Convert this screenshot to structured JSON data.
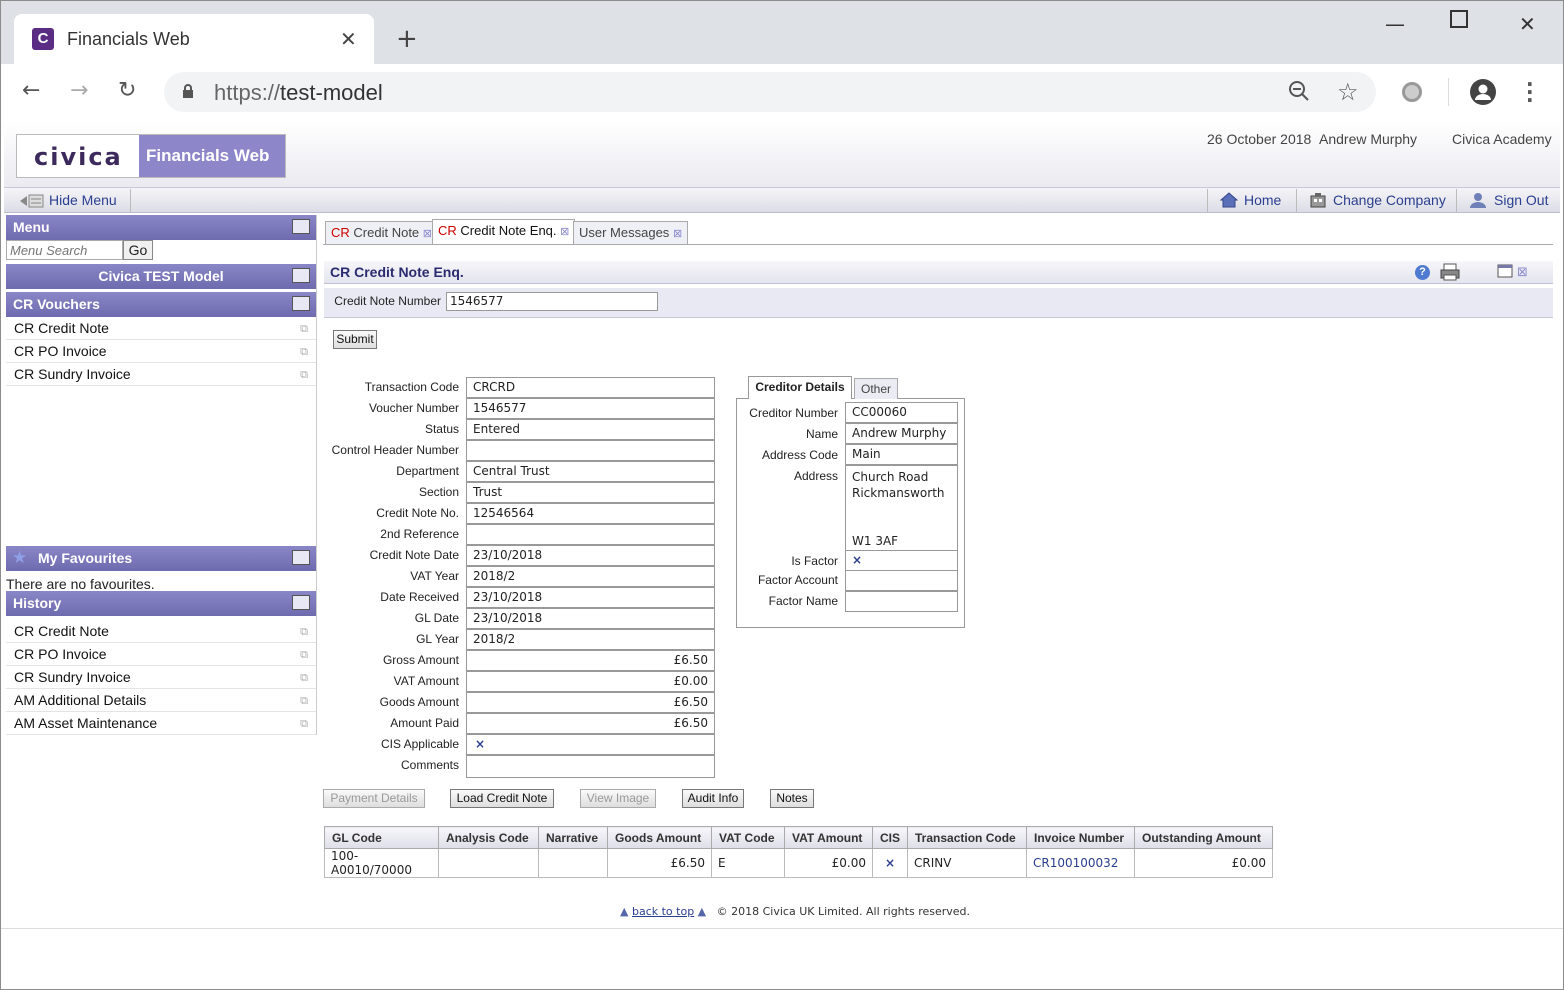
{
  "browser": {
    "tab_title": "Financials Web",
    "favicon_letter": "C",
    "url_scheme": "https://",
    "url_host": "test-model"
  },
  "header": {
    "logo_text": "civica",
    "app_name": "Financials Web",
    "date": "26 October 2018",
    "user": "Andrew Murphy",
    "organisation": "Civica Academy"
  },
  "toolbar": {
    "hide_menu": "Hide Menu",
    "home": "Home",
    "change_company": "Change Company",
    "sign_out": "Sign Out"
  },
  "sidebar": {
    "menu_title": "Menu",
    "search_placeholder": "Menu Search",
    "go_label": "Go",
    "model_title": "Civica TEST Model",
    "vouchers_title": "CR Vouchers",
    "voucher_items": [
      "CR Credit Note",
      "CR PO Invoice",
      "CR Sundry Invoice"
    ],
    "favourites_title": "My Favourites",
    "favourites_empty": "There are no favourites.",
    "history_title": "History",
    "history_items": [
      "CR Credit Note",
      "CR PO Invoice",
      "CR Sundry Invoice",
      "AM Additional Details",
      "AM Asset Maintenance"
    ]
  },
  "tabs": [
    {
      "prefix": "CR",
      "label": "Credit Note"
    },
    {
      "prefix": "CR",
      "label": "Credit Note Enq."
    },
    {
      "prefix": "",
      "label": "User Messages"
    }
  ],
  "form": {
    "title": "CR Credit Note Enq.",
    "search_label": "Credit Note Number",
    "search_value": "1546577",
    "submit_label": "Submit",
    "fields": [
      {
        "label": "Transaction Code",
        "value": "CRCRD"
      },
      {
        "label": "Voucher Number",
        "value": "1546577"
      },
      {
        "label": "Status",
        "value": "Entered"
      },
      {
        "label": "Control Header Number",
        "value": ""
      },
      {
        "label": "Department",
        "value": "Central Trust"
      },
      {
        "label": "Section",
        "value": "Trust"
      },
      {
        "label": "Credit Note No.",
        "value": "12546564"
      },
      {
        "label": "2nd Reference",
        "value": ""
      },
      {
        "label": "Credit Note Date",
        "value": "23/10/2018"
      },
      {
        "label": "VAT Year",
        "value": "2018/2"
      },
      {
        "label": "Date Received",
        "value": "23/10/2018"
      },
      {
        "label": "GL Date",
        "value": "23/10/2018"
      },
      {
        "label": "GL Year",
        "value": "2018/2"
      },
      {
        "label": "Gross Amount",
        "value": "£6.50"
      },
      {
        "label": "VAT Amount",
        "value": "£0.00"
      },
      {
        "label": "Goods Amount",
        "value": "£6.50"
      },
      {
        "label": "Amount Paid",
        "value": "£6.50"
      },
      {
        "label": "CIS Applicable",
        "value": "×"
      },
      {
        "label": "Comments",
        "value": ""
      }
    ]
  },
  "creditor": {
    "tab_details": "Creditor Details",
    "tab_other": "Other",
    "creditor_number_label": "Creditor Number",
    "creditor_number": "CC00060",
    "name_label": "Name",
    "name": "Andrew Murphy",
    "address_code_label": "Address Code",
    "address_code": "Main",
    "address_label": "Address",
    "address_line1": "Church Road",
    "address_line2": "Rickmansworth",
    "postcode": "W1 3AF",
    "is_factor_label": "Is Factor",
    "is_factor": "×",
    "factor_account_label": "Factor Account",
    "factor_account": "",
    "factor_name_label": "Factor Name",
    "factor_name": ""
  },
  "actions": [
    "Payment Details",
    "Load Credit Note",
    "View Image",
    "Audit Info",
    "Notes"
  ],
  "grid": {
    "columns": [
      "GL Code",
      "Analysis Code",
      "Narrative",
      "Goods Amount",
      "VAT Code",
      "VAT Amount",
      "CIS",
      "Transaction Code",
      "Invoice Number",
      "Outstanding Amount"
    ],
    "rows": [
      [
        "100-A0010/70000",
        "",
        "",
        "£6.50",
        "E",
        "£0.00",
        "×",
        "CRINV",
        "CR100100032",
        "£0.00"
      ]
    ]
  },
  "footer": {
    "back_to_top": "back to top",
    "copyright": "© 2018 Civica UK Limited. All rights reserved."
  },
  "colors": {
    "accent": "#6e6aae",
    "brand_purple": "#5b2c83",
    "link": "#2a3f8f",
    "tab_prefix_red": "#cc0000"
  }
}
